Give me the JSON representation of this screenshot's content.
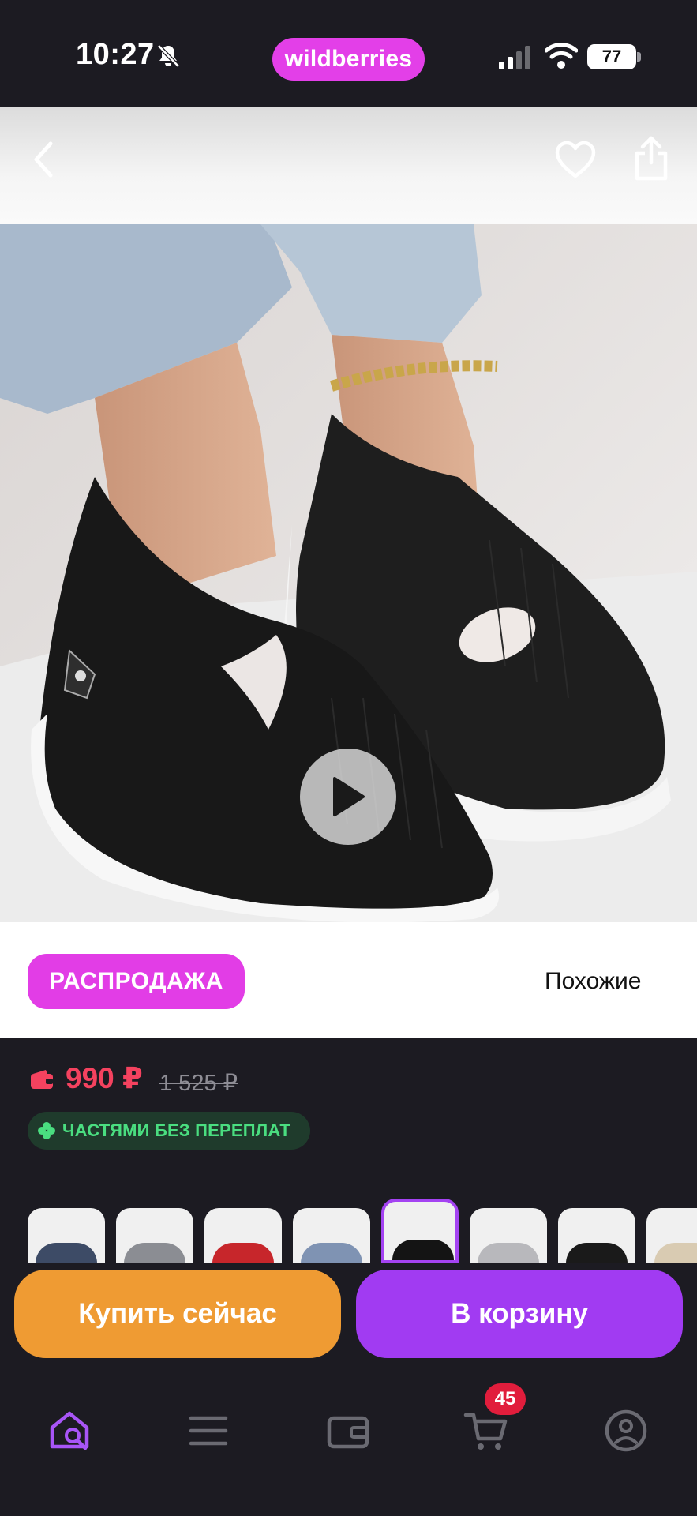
{
  "status_bar": {
    "time": "10:27",
    "brand": "wildberries",
    "battery": "77",
    "icons": [
      "bell-slash-icon",
      "signal-icon",
      "wifi-icon",
      "battery-icon"
    ]
  },
  "top_nav": {
    "icons": [
      "back-chevron-icon",
      "heart-icon",
      "share-icon"
    ]
  },
  "product": {
    "video_play_icon": "play-icon",
    "sale_badge": "РАСПРОДАЖА",
    "similar_link": "Похожие",
    "price": "990 ₽",
    "old_price": "1 525 ₽",
    "installments_label": "ЧАСТЯМИ БЕЗ ПЕРЕПЛАТ",
    "thumbnails": [
      {
        "color": "#3d4b66",
        "selected": false
      },
      {
        "color": "#8b8d93",
        "selected": false
      },
      {
        "color": "#c7262b",
        "selected": false
      },
      {
        "color": "#7f93b3",
        "selected": false
      },
      {
        "color": "#141414",
        "selected": true
      },
      {
        "color": "#b8b8bc",
        "selected": false
      },
      {
        "color": "#1a1a1a",
        "selected": false
      },
      {
        "color": "#d9cbb2",
        "selected": false
      }
    ]
  },
  "actions": {
    "buy_now": "Купить сейчас",
    "add_to_cart": "В корзину"
  },
  "tab_bar": {
    "items": [
      "home-search-icon",
      "catalog-menu-icon",
      "wallet-icon",
      "cart-icon",
      "profile-icon"
    ],
    "cart_count": "45",
    "active_color": "#a855f7"
  },
  "colors": {
    "brand_pink": "#e33fe8",
    "price_red": "#f4425f",
    "buy_orange": "#ef9b33",
    "cart_purple": "#a13bf2"
  }
}
